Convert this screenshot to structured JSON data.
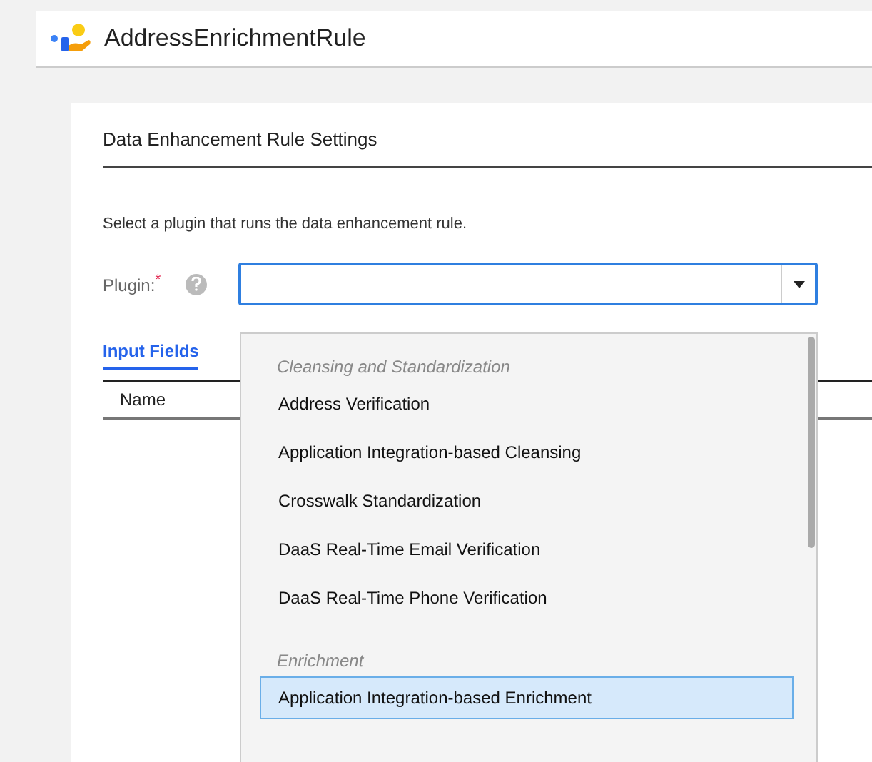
{
  "header": {
    "title": "AddressEnrichmentRule"
  },
  "section": {
    "title": "Data Enhancement Rule Settings",
    "description": "Select a plugin that runs the data enhancement rule."
  },
  "plugin": {
    "label": "Plugin:",
    "required_mark": "*"
  },
  "tabs": [
    {
      "label": "Input Fields",
      "selected": true
    }
  ],
  "table": {
    "columns": [
      "Name"
    ]
  },
  "dropdown": {
    "items": [
      {
        "kind": "group",
        "label": "Cleansing and Standardization"
      },
      {
        "kind": "option",
        "label": "Address Verification",
        "selected": false
      },
      {
        "kind": "option",
        "label": "Application Integration-based Cleansing",
        "selected": false
      },
      {
        "kind": "option",
        "label": "Crosswalk Standardization",
        "selected": false
      },
      {
        "kind": "option",
        "label": "DaaS Real-Time Email Verification",
        "selected": false
      },
      {
        "kind": "option",
        "label": "DaaS Real-Time Phone Verification",
        "selected": false
      },
      {
        "kind": "group",
        "label": "Enrichment"
      },
      {
        "kind": "option",
        "label": "Application Integration-based Enrichment",
        "selected": true
      }
    ]
  }
}
